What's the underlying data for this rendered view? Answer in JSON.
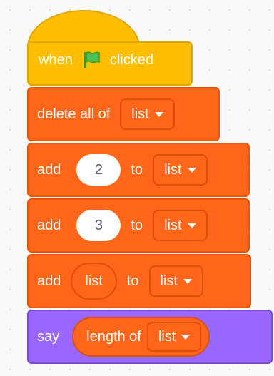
{
  "script": {
    "hat": {
      "prefix": "when",
      "suffix": "clicked",
      "flag_icon": "green-flag-icon",
      "color": "#ffbf00"
    },
    "delete_all": {
      "label": "delete all of",
      "list": "list"
    },
    "add1": {
      "label": "add",
      "value": "2",
      "to": "to",
      "list": "list"
    },
    "add2": {
      "label": "add",
      "value": "3",
      "to": "to",
      "list": "list"
    },
    "add3": {
      "label": "add",
      "reporter": "list",
      "to": "to",
      "list": "list"
    },
    "say": {
      "label": "say",
      "reporter": "length of",
      "list": "list"
    }
  },
  "colors": {
    "data": "#ff6619",
    "looks": "#9966ff",
    "events": "#ffbf00"
  }
}
